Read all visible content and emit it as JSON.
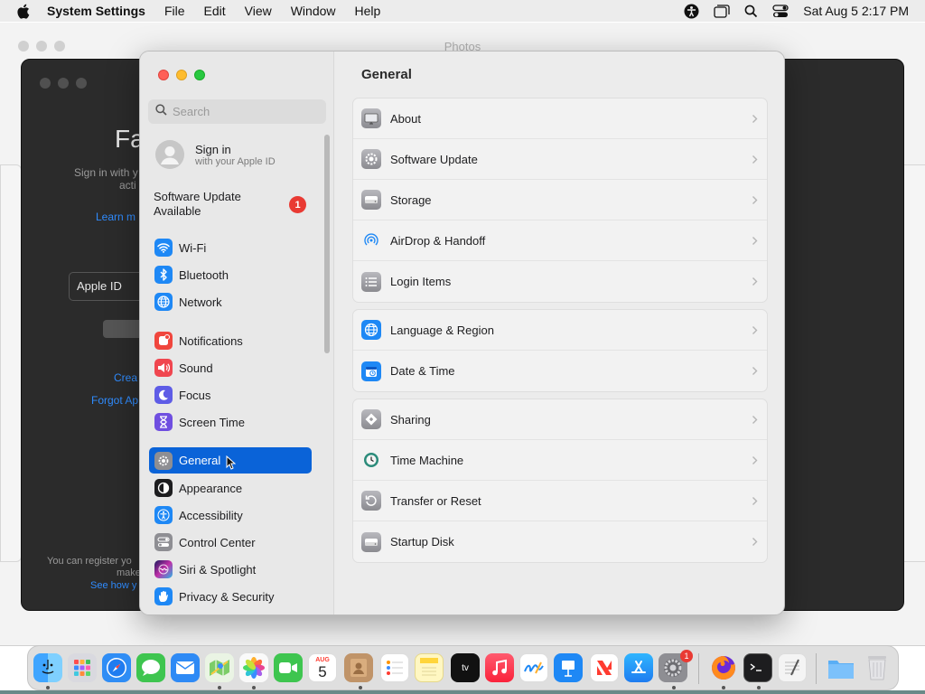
{
  "menubar": {
    "app_name": "System Settings",
    "items": [
      "File",
      "Edit",
      "View",
      "Window",
      "Help"
    ],
    "clock": "Sat Aug 5  2:17 PM"
  },
  "background_window": {
    "title": "Photos",
    "heading_fragment": "Fa",
    "sign_text_1": "Sign in with y",
    "sign_text_2": "acti",
    "learn_more": "Learn m",
    "apple_id_field": "Apple ID",
    "create_link": "Crea",
    "forgot_link": "Forgot Ap",
    "footer_1": "You can register yo",
    "footer_2": "make",
    "footer_link": "See how y"
  },
  "sidebar": {
    "search_placeholder": "Search",
    "signin_title": "Sign in",
    "signin_subtitle": "with your Apple ID",
    "update_line1": "Software Update",
    "update_line2": "Available",
    "update_badge": "1",
    "items": [
      {
        "label": "Wi-Fi",
        "icon": "wifi-icon",
        "color": "#1e88f5"
      },
      {
        "label": "Bluetooth",
        "icon": "bluetooth-icon",
        "color": "#1e88f5"
      },
      {
        "label": "Network",
        "icon": "globe-icon",
        "color": "#1e88f5"
      },
      {
        "label": "Notifications",
        "icon": "bell-icon",
        "color": "#f0463d"
      },
      {
        "label": "Sound",
        "icon": "speaker-icon",
        "color": "#f0464f"
      },
      {
        "label": "Focus",
        "icon": "moon-icon",
        "color": "#5e5ce6"
      },
      {
        "label": "Screen Time",
        "icon": "hourglass-icon",
        "color": "#6f4ee0"
      },
      {
        "label": "General",
        "icon": "gear-icon",
        "color": "#8e8e93"
      },
      {
        "label": "Appearance",
        "icon": "appearance-icon",
        "color": "#1d1d1f"
      },
      {
        "label": "Accessibility",
        "icon": "accessibility-icon",
        "color": "#1e88f5"
      },
      {
        "label": "Control Center",
        "icon": "control-center-icon",
        "color": "#8e8e93"
      },
      {
        "label": "Siri & Spotlight",
        "icon": "siri-icon",
        "color": "#2d2d8a"
      },
      {
        "label": "Privacy & Security",
        "icon": "hand-icon",
        "color": "#1e88f5"
      }
    ]
  },
  "main": {
    "title": "General",
    "groups": [
      [
        {
          "label": "About",
          "icon": "display-icon"
        },
        {
          "label": "Software Update",
          "icon": "gear-badge-icon"
        },
        {
          "label": "Storage",
          "icon": "disk-icon"
        },
        {
          "label": "AirDrop & Handoff",
          "icon": "airdrop-icon"
        },
        {
          "label": "Login Items",
          "icon": "list-icon"
        }
      ],
      [
        {
          "label": "Language & Region",
          "icon": "globe-icon"
        },
        {
          "label": "Date & Time",
          "icon": "calendar-icon"
        }
      ],
      [
        {
          "label": "Sharing",
          "icon": "sharing-icon"
        },
        {
          "label": "Time Machine",
          "icon": "time-machine-icon"
        },
        {
          "label": "Transfer or Reset",
          "icon": "reset-icon"
        },
        {
          "label": "Startup Disk",
          "icon": "startup-disk-icon"
        }
      ]
    ]
  },
  "dock": {
    "calendar_month": "AUG",
    "calendar_day": "5",
    "settings_badge": "1",
    "tv_label": "tv"
  }
}
